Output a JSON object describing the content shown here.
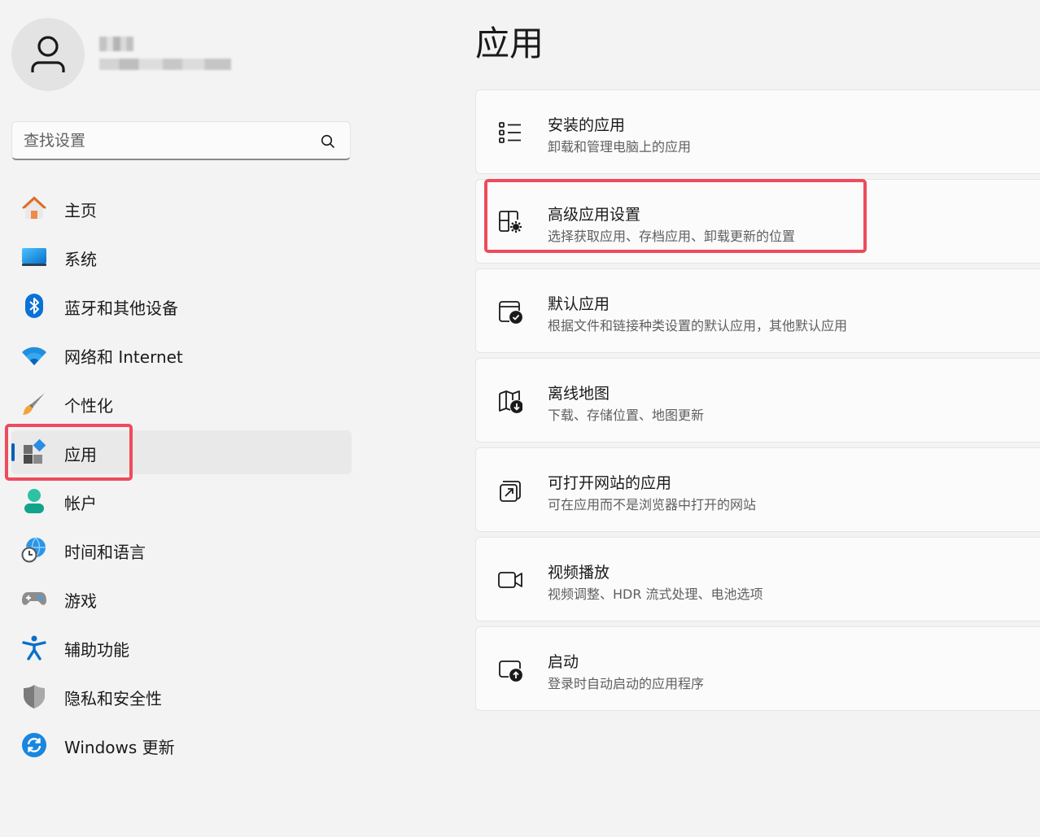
{
  "search": {
    "placeholder": "查找设置",
    "value": ""
  },
  "nav": {
    "items": [
      {
        "label": "主页",
        "icon": "home-icon"
      },
      {
        "label": "系统",
        "icon": "system-icon"
      },
      {
        "label": "蓝牙和其他设备",
        "icon": "bluetooth-icon"
      },
      {
        "label": "网络和 Internet",
        "icon": "wifi-icon"
      },
      {
        "label": "个性化",
        "icon": "brush-icon"
      },
      {
        "label": "应用",
        "icon": "apps-icon",
        "selected": true
      },
      {
        "label": "帐户",
        "icon": "account-icon"
      },
      {
        "label": "时间和语言",
        "icon": "globe-clock-icon"
      },
      {
        "label": "游戏",
        "icon": "gamepad-icon"
      },
      {
        "label": "辅助功能",
        "icon": "accessibility-icon"
      },
      {
        "label": "隐私和安全性",
        "icon": "shield-icon"
      },
      {
        "label": "Windows 更新",
        "icon": "update-icon"
      }
    ]
  },
  "main": {
    "title": "应用",
    "cards": [
      {
        "title": "安装的应用",
        "subtitle": "卸载和管理电脑上的应用",
        "icon": "list-icon"
      },
      {
        "title": "高级应用设置",
        "subtitle": "选择获取应用、存档应用、卸载更新的位置",
        "icon": "app-settings-icon"
      },
      {
        "title": "默认应用",
        "subtitle": "根据文件和链接种类设置的默认应用，其他默认应用",
        "icon": "default-apps-icon"
      },
      {
        "title": "离线地图",
        "subtitle": "下载、存储位置、地图更新",
        "icon": "map-download-icon"
      },
      {
        "title": "可打开网站的应用",
        "subtitle": "可在应用而不是浏览器中打开的网站",
        "icon": "open-external-icon"
      },
      {
        "title": "视频播放",
        "subtitle": "视频调整、HDR 流式处理、电池选项",
        "icon": "video-icon"
      },
      {
        "title": "启动",
        "subtitle": "登录时自动启动的应用程序",
        "icon": "startup-icon"
      }
    ]
  },
  "colors": {
    "accent": "#005fb8",
    "highlight": "#ee4b5c",
    "background": "#f3f3f3",
    "card": "#fbfbfb"
  }
}
